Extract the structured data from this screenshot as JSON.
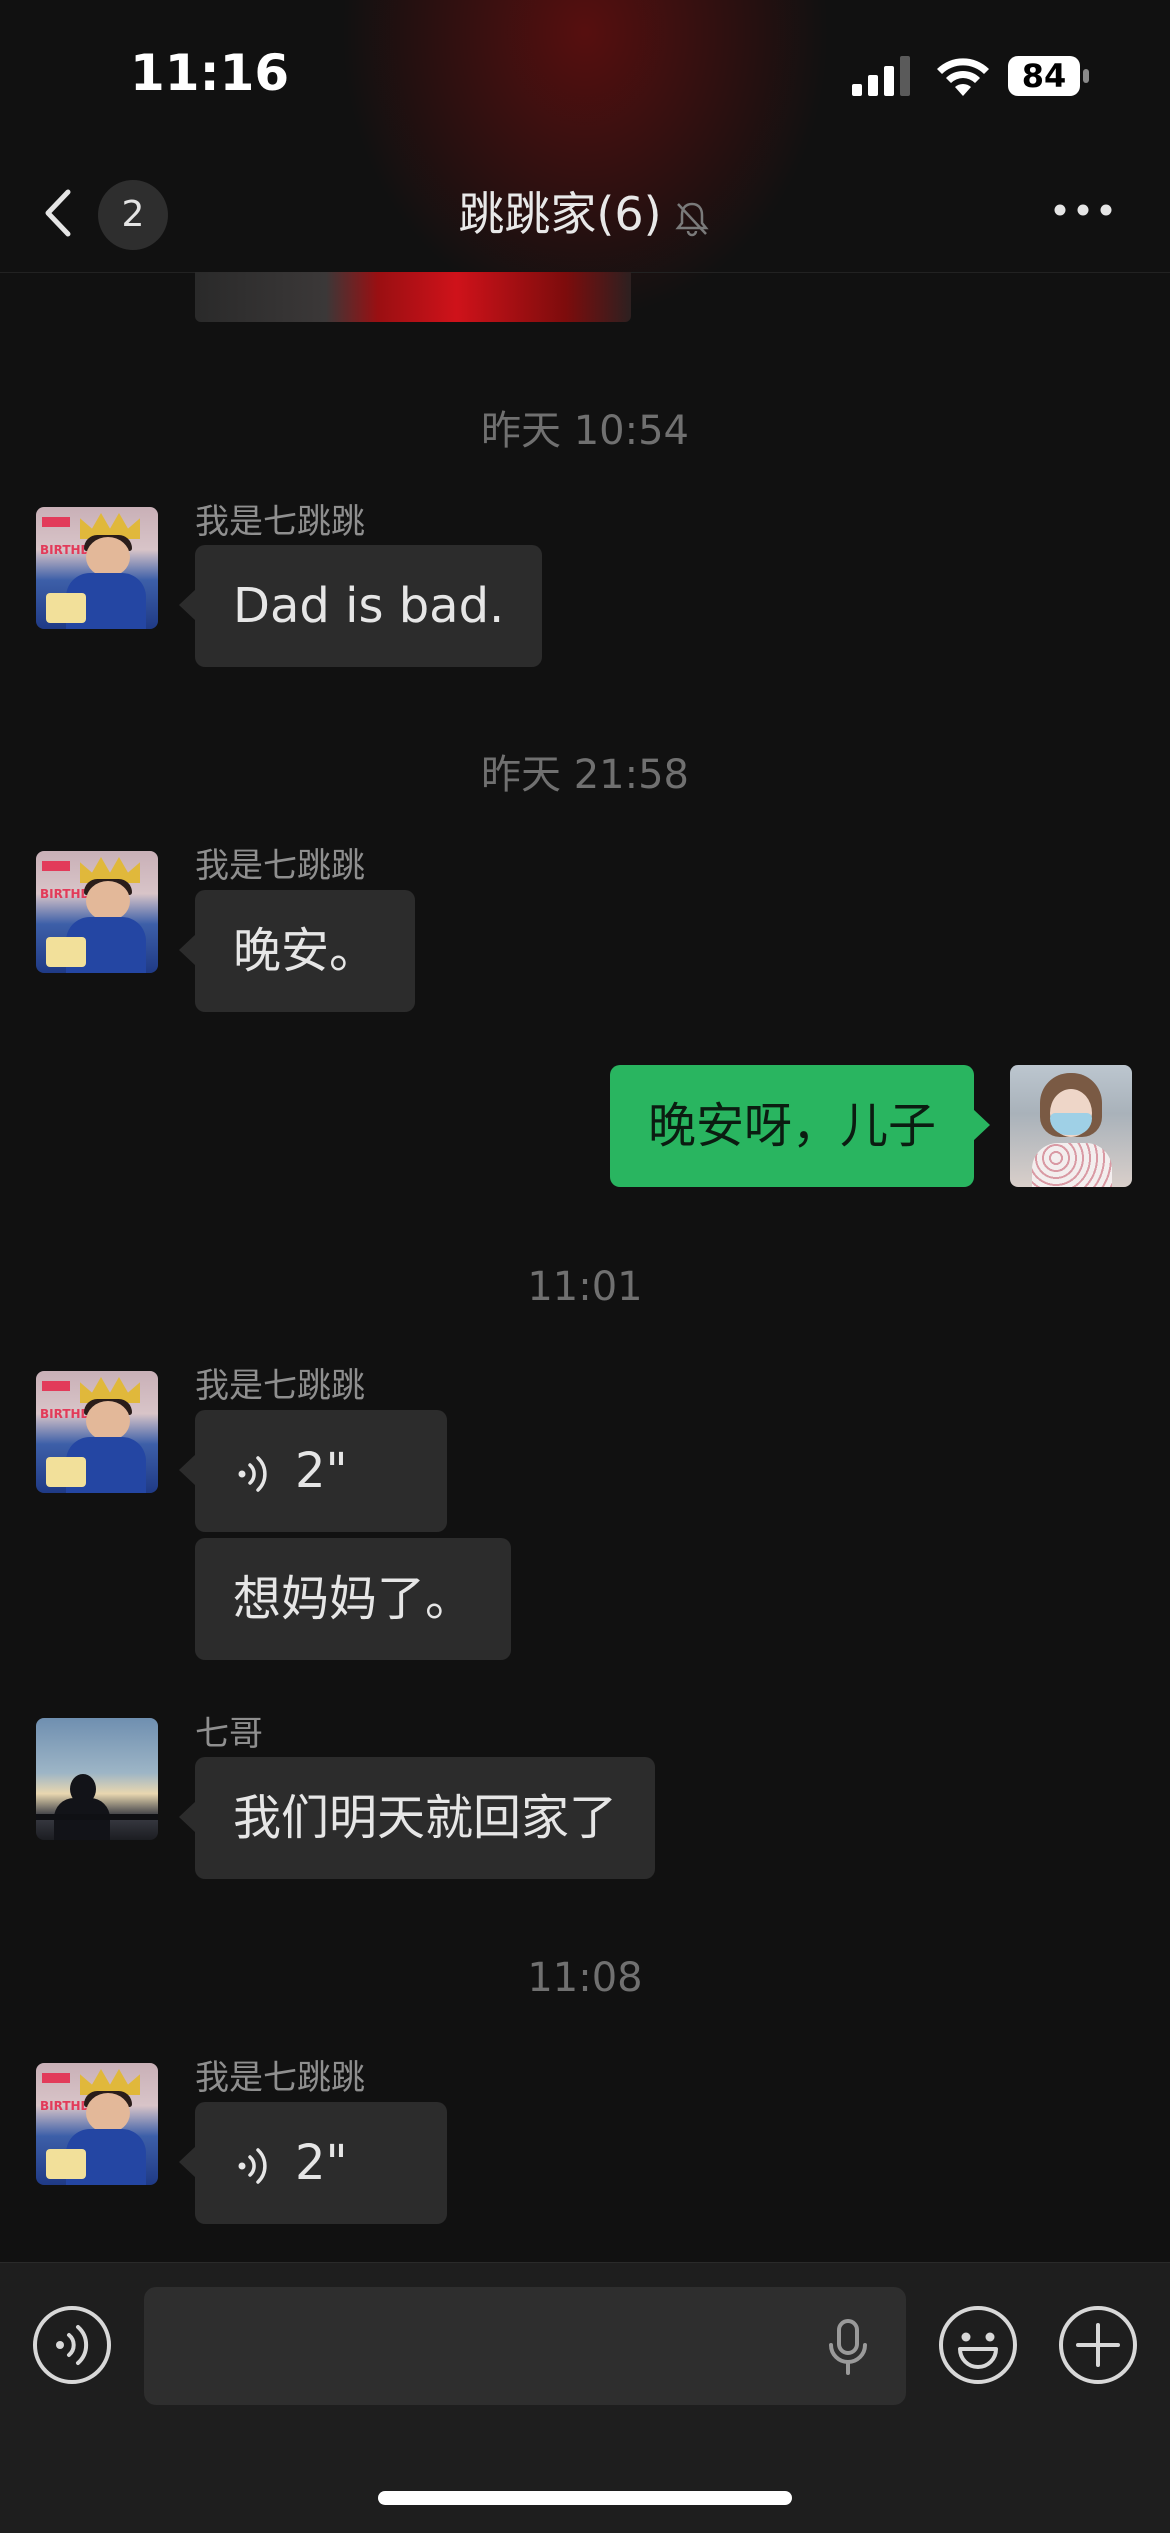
{
  "status_bar": {
    "time": "11:16",
    "battery": "84",
    "icons": [
      "signal-icon",
      "wifi-icon",
      "battery-icon"
    ]
  },
  "nav": {
    "back_icon": "chevron-left-icon",
    "unread_count": "2",
    "title": "跳跳家(6)",
    "mute_icon": "bell-slash-icon",
    "more_icon": "more-dots-icon"
  },
  "messages": [
    {
      "type": "timestamp",
      "text": "昨天 10:54"
    },
    {
      "type": "message",
      "sender": "我是七跳跳",
      "content": "Dad is bad."
    },
    {
      "type": "timestamp",
      "text": "昨天 21:58"
    },
    {
      "type": "message",
      "sender": "我是七跳跳",
      "content": "晚安。"
    },
    {
      "type": "message",
      "sender": "",
      "mine": true,
      "content": "晚安呀，儿子"
    },
    {
      "type": "timestamp",
      "text": "11:01"
    },
    {
      "type": "voice",
      "sender": "我是七跳跳",
      "duration": "2\""
    },
    {
      "type": "message",
      "sender": "我是七跳跳",
      "content": "想妈妈了。"
    },
    {
      "type": "message",
      "sender": "七哥",
      "content": "我们明天就回家了"
    },
    {
      "type": "timestamp",
      "text": "11:08"
    },
    {
      "type": "voice",
      "sender": "我是七跳跳",
      "duration": "2\""
    }
  ],
  "input_bar": {
    "voice_toggle_icon": "voice-input-icon",
    "mic_icon": "microphone-icon",
    "emoji_icon": "emoji-icon",
    "plus_icon": "plus-icon",
    "placeholder": ""
  },
  "colors": {
    "background": "#111111",
    "bubble_other": "#2c2c2c",
    "bubble_mine": "#29b560",
    "timestamp": "#707070"
  }
}
